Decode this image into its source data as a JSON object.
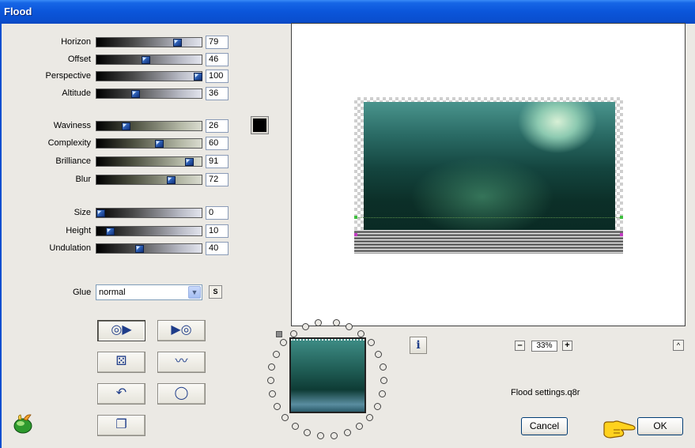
{
  "window": {
    "title": "Flood"
  },
  "sliders_group1": [
    {
      "key": "horizon",
      "label": "Horizon",
      "value": 79
    },
    {
      "key": "offset",
      "label": "Offset",
      "value": 46
    },
    {
      "key": "perspective",
      "label": "Perspective",
      "value": 100
    },
    {
      "key": "altitude",
      "label": "Altitude",
      "value": 36
    }
  ],
  "sliders_group2": [
    {
      "key": "waviness",
      "label": "Waviness",
      "value": 26
    },
    {
      "key": "complexity",
      "label": "Complexity",
      "value": 60
    },
    {
      "key": "brilliance",
      "label": "Brilliance",
      "value": 91
    },
    {
      "key": "blur",
      "label": "Blur",
      "value": 72
    }
  ],
  "sliders_group3": [
    {
      "key": "size",
      "label": "Size",
      "value": 0
    },
    {
      "key": "height",
      "label": "Height",
      "value": 10
    },
    {
      "key": "undulation",
      "label": "Undulation",
      "value": 40
    }
  ],
  "color": {
    "swatch": "#000000"
  },
  "glue": {
    "label": "Glue",
    "value": "normal",
    "s_button": "S"
  },
  "toolbar": {
    "buttons": [
      {
        "name": "play-preview-button",
        "icon": "disc-play-icon",
        "glyph": "◎▶"
      },
      {
        "name": "forward-preview-button",
        "icon": "play-disc-icon",
        "glyph": "▶◎"
      },
      {
        "name": "randomize-button",
        "icon": "dice-icon",
        "glyph": "⚄"
      },
      {
        "name": "wave-button",
        "icon": "wave-icon",
        "glyph": "〰"
      },
      {
        "name": "undo-button",
        "icon": "undo-arrow-icon",
        "glyph": "↶"
      },
      {
        "name": "reset-button",
        "icon": "ring-icon",
        "glyph": "◯"
      },
      {
        "name": "copy-button",
        "icon": "copy-icon",
        "glyph": "❐"
      }
    ]
  },
  "preview": {
    "zoom": "33%"
  },
  "navigator": {
    "info_glyph": "i",
    "minus": "–",
    "plus": "+",
    "up": "^"
  },
  "settings_file": "Flood settings.q8r",
  "buttons": {
    "cancel": "Cancel",
    "ok": "OK"
  },
  "colors": {
    "titlebar": "#0b55da",
    "accent_blue": "#2d5fb4",
    "xp_button_border": "#003c74"
  }
}
